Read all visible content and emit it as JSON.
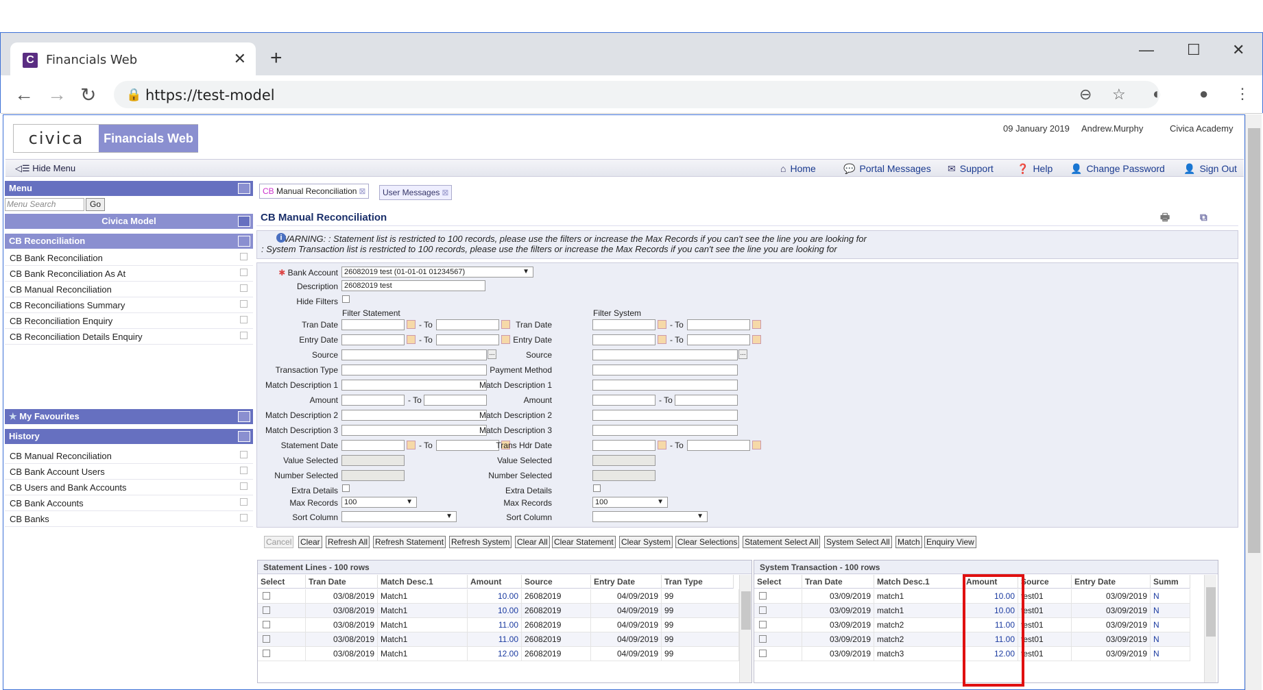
{
  "browser": {
    "tab_title": "Financials Web",
    "url": "https://test-model"
  },
  "app": {
    "logo": "civica",
    "name": "Financials Web",
    "date": "09 January 2019",
    "user": "Andrew.Murphy",
    "org": "Civica Academy",
    "hide_menu": "Hide Menu",
    "top_links": [
      "Home",
      "Portal Messages",
      "Support",
      "Help",
      "Change Password",
      "Sign Out"
    ]
  },
  "menu": {
    "title": "Menu",
    "search_placeholder": "Menu Search",
    "go": "Go",
    "model": "Civica Model",
    "section": "CB Reconciliation",
    "items": [
      "CB Bank Reconciliation",
      "CB Bank Reconciliation As At",
      "CB Manual Reconciliation",
      "CB Reconciliations Summary",
      "CB Reconciliation Enquiry",
      "CB Reconciliation Details Enquiry"
    ],
    "favourites": "My Favourites",
    "history_title": "History",
    "history": [
      "CB Manual Reconciliation",
      "CB Bank Account Users",
      "CB Users and Bank Accounts",
      "CB Bank Accounts",
      "CB Banks"
    ]
  },
  "tabs": {
    "active_prefix": "CB",
    "active": "Manual Reconciliation",
    "inactive": "User Messages"
  },
  "panel": {
    "title": "CB Manual Reconciliation",
    "warning1": "WARNING: : Statement list is restricted to 100 records, please use the filters or increase the Max Records if you can't see the line you are looking for",
    "warning2": ": System Transaction list is restricted to 100 records, please use the filters or increase the Max Records if you can't see the line you are looking for"
  },
  "form": {
    "bank_account_label": "Bank Account",
    "bank_account_value": "26082019 test (01-01-01 01234567)",
    "description_label": "Description",
    "description_value": "26082019 test",
    "hide_filters": "Hide Filters",
    "filter_statement": "Filter Statement",
    "filter_system": "Filter System",
    "to": "- To",
    "left_labels": [
      "Tran Date",
      "Entry Date",
      "Source",
      "Transaction Type",
      "Match Description 1",
      "Amount",
      "Match Description 2",
      "Match Description 3",
      "Statement Date",
      "Value Selected",
      "Number Selected",
      "Extra Details",
      "Max Records",
      "Sort Column"
    ],
    "right_labels": [
      "Tran Date",
      "Entry Date",
      "Source",
      "Payment Method",
      "Match Description 1",
      "Amount",
      "Match Description 2",
      "Match Description 3",
      "Trans Hdr Date",
      "Value Selected",
      "Number Selected",
      "Extra Details",
      "Max Records",
      "Sort Column"
    ],
    "max_records_left": "100",
    "max_records_right": "100"
  },
  "actions": [
    "Cancel",
    "Clear",
    "Refresh All",
    "Refresh Statement",
    "Refresh System",
    "Clear All",
    "Clear Statement",
    "Clear System",
    "Clear Selections",
    "Statement Select All",
    "System Select All",
    "Match",
    "Enquiry View"
  ],
  "statement_grid": {
    "title": "Statement Lines - 100 rows",
    "columns": [
      "Select",
      "Tran Date",
      "Match Desc.1",
      "Amount",
      "Source",
      "Entry Date",
      "Tran Type"
    ],
    "rows": [
      [
        "03/08/2019",
        "Match1",
        "10.00",
        "26082019",
        "04/09/2019",
        "99"
      ],
      [
        "03/08/2019",
        "Match1",
        "10.00",
        "26082019",
        "04/09/2019",
        "99"
      ],
      [
        "03/08/2019",
        "Match1",
        "11.00",
        "26082019",
        "04/09/2019",
        "99"
      ],
      [
        "03/08/2019",
        "Match1",
        "11.00",
        "26082019",
        "04/09/2019",
        "99"
      ],
      [
        "03/08/2019",
        "Match1",
        "12.00",
        "26082019",
        "04/09/2019",
        "99"
      ]
    ]
  },
  "system_grid": {
    "title": "System Transaction - 100 rows",
    "columns": [
      "Select",
      "Tran Date",
      "Match Desc.1",
      "Amount",
      "Source",
      "Entry Date",
      "Summ"
    ],
    "rows": [
      [
        "03/09/2019",
        "match1",
        "10.00",
        "test01",
        "03/09/2019",
        "N"
      ],
      [
        "03/09/2019",
        "match1",
        "10.00",
        "test01",
        "03/09/2019",
        "N"
      ],
      [
        "03/09/2019",
        "match2",
        "11.00",
        "test01",
        "03/09/2019",
        "N"
      ],
      [
        "03/09/2019",
        "match2",
        "11.00",
        "test01",
        "03/09/2019",
        "N"
      ],
      [
        "03/09/2019",
        "match3",
        "12.00",
        "test01",
        "03/09/2019",
        "N"
      ]
    ]
  }
}
